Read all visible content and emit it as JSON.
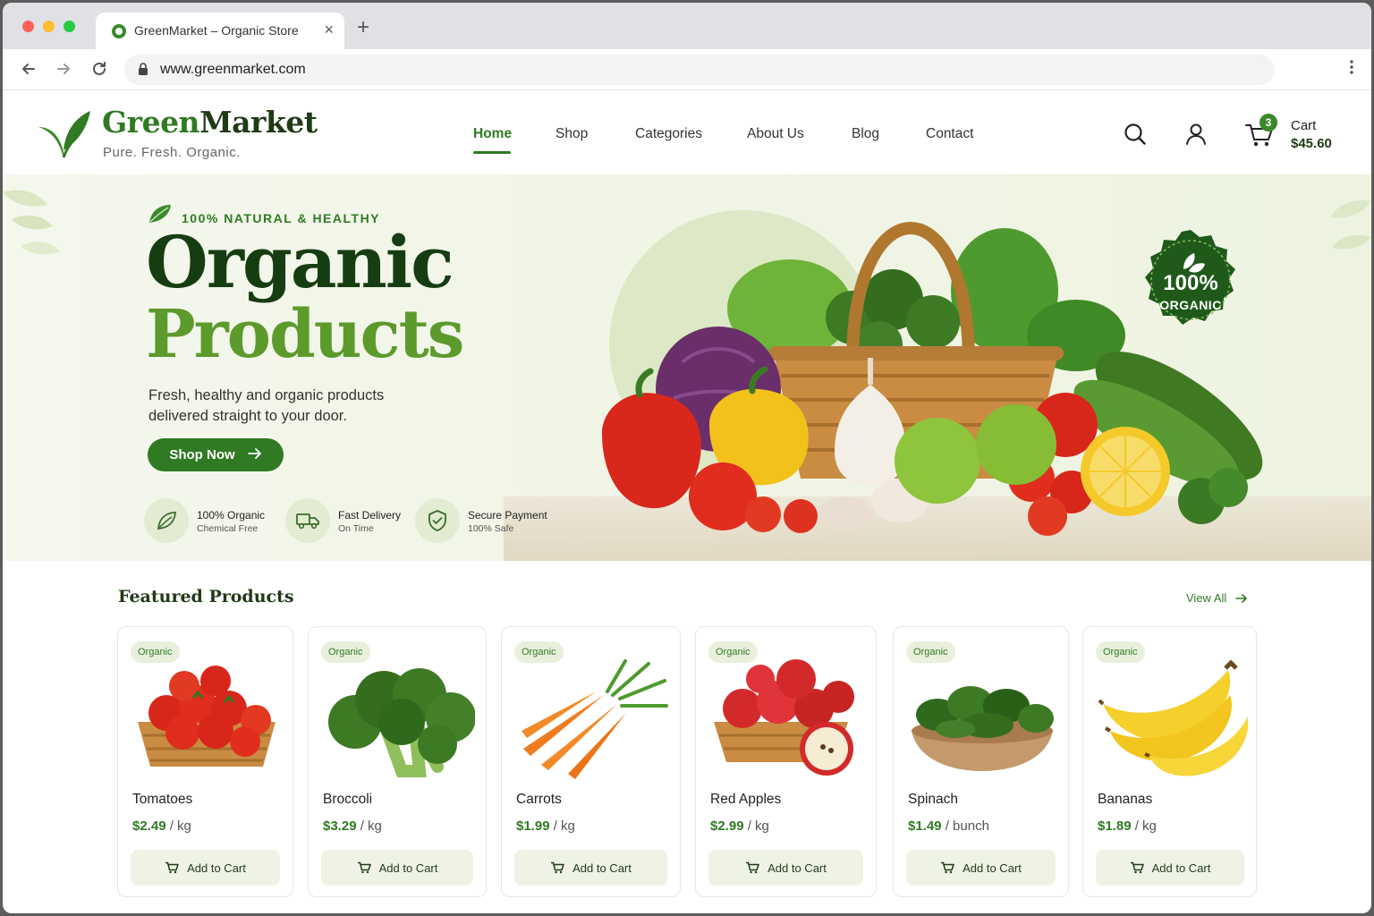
{
  "browser": {
    "tab_title": "GreenMarket – Organic Store",
    "url": "www.greenmarket.com"
  },
  "site": {
    "logo_green": "Green",
    "logo_market": "Market",
    "tagline": "Pure. Fresh. Organic.",
    "nav": [
      "Home",
      "Shop",
      "Categories",
      "About Us",
      "Blog",
      "Contact"
    ],
    "active_nav": "Home",
    "cart_count": "3",
    "cart_label": "Cart",
    "cart_total": "$45.60"
  },
  "hero": {
    "tag": "100% NATURAL & HEALTHY",
    "title_line1": "Organic",
    "title_line2": "Products",
    "subtitle": "Fresh, healthy and organic products delivered straight to your door.",
    "cta": "Shop Now",
    "features": [
      {
        "title": "100% Organic",
        "sub": "Chemical Free",
        "icon": "leaf-icon"
      },
      {
        "title": "Fast Delivery",
        "sub": "On Time",
        "icon": "truck-icon"
      },
      {
        "title": "Secure Payment",
        "sub": "100% Safe",
        "icon": "shield-icon"
      }
    ],
    "badge_pct": "100%",
    "badge_label": "ORGANIC"
  },
  "featured": {
    "title": "Featured Products",
    "view_all": "View All",
    "products": [
      {
        "badge": "Organic",
        "name": "Tomatoes",
        "price": "$2.49",
        "unit": "/ kg",
        "cta": "Add to Cart"
      },
      {
        "badge": "Organic",
        "name": "Broccoli",
        "price": "$3.29",
        "unit": "/ kg",
        "cta": "Add to Cart"
      },
      {
        "badge": "Organic",
        "name": "Carrots",
        "price": "$1.99",
        "unit": "/ kg",
        "cta": "Add to Cart"
      },
      {
        "badge": "Organic",
        "name": "Red Apples",
        "price": "$2.99",
        "unit": "/ kg",
        "cta": "Add to Cart"
      },
      {
        "badge": "Organic",
        "name": "Spinach",
        "price": "$1.49",
        "unit": "/ bunch",
        "cta": "Add to Cart"
      },
      {
        "badge": "Organic",
        "name": "Bananas",
        "price": "$1.89",
        "unit": "/ kg",
        "cta": "Add to Cart"
      }
    ]
  },
  "colors": {
    "brand_green": "#2f7a23",
    "dark_green": "#163d12",
    "light_green": "#5c9a2c"
  }
}
